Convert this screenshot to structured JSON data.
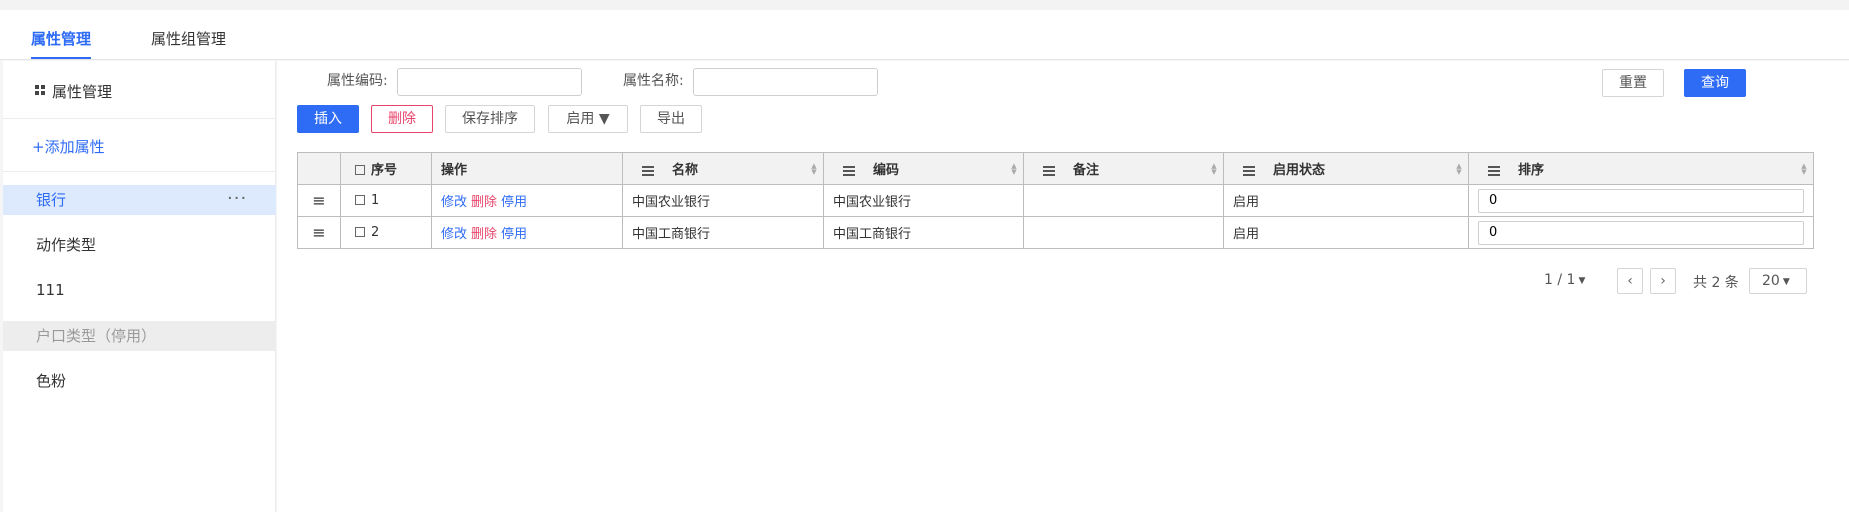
{
  "tabs": [
    {
      "label": "属性管理",
      "active": true
    },
    {
      "label": "属性组管理",
      "active": false
    }
  ],
  "sidebar": {
    "title": "属性管理",
    "add_label": "+添加属性",
    "more_icon": "···",
    "items": [
      {
        "label": "银行",
        "state": "selected"
      },
      {
        "label": "动作类型",
        "state": "normal"
      },
      {
        "label": "111",
        "state": "normal"
      },
      {
        "label": "户口类型（停用）",
        "state": "disabled"
      },
      {
        "label": "色粉",
        "state": "normal"
      }
    ]
  },
  "filters": {
    "code_label": "属性编码:",
    "code_value": "",
    "name_label": "属性名称:",
    "name_value": ""
  },
  "buttons": {
    "reset": "重置",
    "query": "查询",
    "insert": "插入",
    "delete": "删除",
    "save_order": "保存排序",
    "enable": "启用 ▼",
    "export": "导出"
  },
  "table": {
    "select_all_label": "序号",
    "columns": [
      "操作",
      "名称",
      "编码",
      "备注",
      "启用状态",
      "排序"
    ],
    "rows": [
      {
        "seq": "1",
        "actions": [
          "修改",
          "删除",
          "停用"
        ],
        "name": "中国农业银行",
        "code": "中国农业银行",
        "remark": "",
        "status": "启用",
        "order": "0"
      },
      {
        "seq": "2",
        "actions": [
          "修改",
          "删除",
          "停用"
        ],
        "name": "中国工商银行",
        "code": "中国工商银行",
        "remark": "",
        "status": "启用",
        "order": "0"
      }
    ]
  },
  "pager": {
    "page": "1 / 1",
    "prev": "‹",
    "next": "›",
    "total": "共 2 条",
    "page_size": "20"
  },
  "colors": {
    "accent": "#2f6cf6",
    "danger": "#e8446b",
    "selected_bg": "#dde9fc"
  }
}
